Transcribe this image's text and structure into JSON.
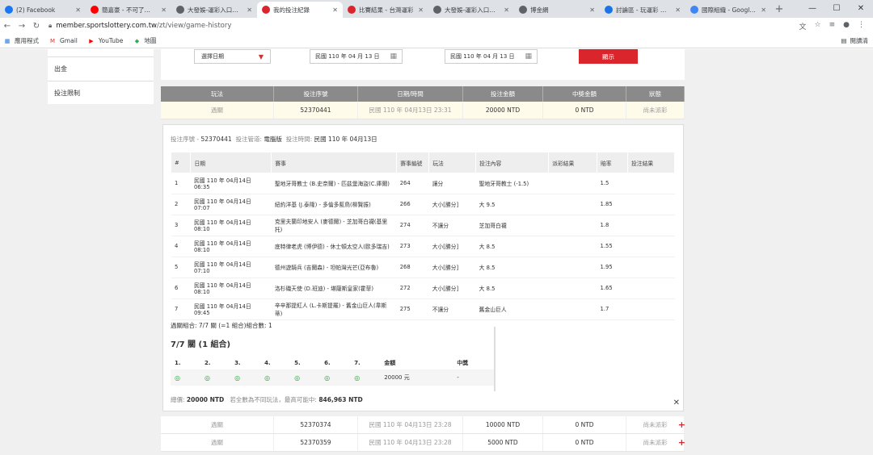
{
  "browser": {
    "tabs": [
      {
        "title": "(2) Facebook",
        "color": "#1877f2"
      },
      {
        "title": "簡嘉豪 - 不可了…",
        "color": "#ff0000"
      },
      {
        "title": "大發娛-運彩入口網 …",
        "color": "#5f6368"
      },
      {
        "title": "我的投注紀錄",
        "color": "#d9252b"
      },
      {
        "title": "比賽結果 - 台灣運彩",
        "color": "#d9252b"
      },
      {
        "title": "大發娛-運彩入口網 …",
        "color": "#5f6368"
      },
      {
        "title": "博金網",
        "color": "#5f6368"
      },
      {
        "title": "討論區 - 玩運彩 台灣 …",
        "color": "#1a73e8"
      },
      {
        "title": "國際組織 - Google 搜 …",
        "color": "#4285f4"
      }
    ],
    "url_host": "member.sportslottery.com.tw",
    "url_path": "/zt/view/game-history",
    "bookmarks": [
      "應用程式",
      "Gmail",
      "YouTube",
      "地圖"
    ],
    "reading_list": "閱讀清"
  },
  "sidebar": {
    "items": [
      "出金",
      "投注限制"
    ]
  },
  "filter": {
    "select_label": "選擇日期",
    "date_from": "民國 110 年 04 月 13 日",
    "date_to": "民國 110 年 04 月 13 日",
    "button": "顯示"
  },
  "history": {
    "headers": [
      "玩法",
      "投注序號",
      "日期/時間",
      "投注金額",
      "中獎金額",
      "狀態"
    ],
    "rows": [
      [
        "過關",
        "52370441",
        "民國 110 年 04月13日 23:31",
        "20000 NTD",
        "0 NTD",
        "尚未派彩"
      ],
      [
        "過關",
        "52370374",
        "民國 110 年 04月13日 23:28",
        "10000 NTD",
        "0 NTD",
        "尚未派彩"
      ],
      [
        "過關",
        "52370359",
        "民國 110 年 04月13日 23:28",
        "5000 NTD",
        "0 NTD",
        "尚未派彩"
      ]
    ]
  },
  "detail": {
    "serial_label": "投注序號",
    "serial": "52370441",
    "channel_label": "投注管道",
    "channel": "電腦版",
    "time_label": "投注時間",
    "time": "民國 110 年 04月13日",
    "headers": [
      "#",
      "日期",
      "賽事",
      "賽事編號",
      "玩法",
      "投注內容",
      "派彩結果",
      "賠率",
      "投注結果"
    ],
    "bets": [
      [
        "1",
        "民國 110 年 04月14日 06:35",
        "聖地牙哥教士 (B.史奈爾) - 匹茲堡海盜(C.庫爾)",
        "264",
        "讓分",
        "聖地牙哥教士 (-1.5)",
        "",
        "1.5",
        ""
      ],
      [
        "2",
        "民國 110 年 04月14日 07:07",
        "紐約洋基 (J.泰隆) - 多倫多藍鳥(柳賢振)",
        "266",
        "大小[勝分]",
        "大 9.5",
        "",
        "1.85",
        ""
      ],
      [
        "3",
        "民國 110 年 04月14日 08:10",
        "克里夫蘭印地安人 (麥德爾) - 芝加哥白襪(基里托)",
        "274",
        "不讓分",
        "芝加哥白襪",
        "",
        "1.8",
        ""
      ],
      [
        "4",
        "民國 110 年 04月14日 08:10",
        "底特律老虎 (博伊德) - 休士頓太空人(歐多瑞吉)",
        "273",
        "大小[勝分]",
        "大 8.5",
        "",
        "1.55",
        ""
      ],
      [
        "5",
        "民國 110 年 04月14日 07:10",
        "德州遊騎兵 (吉爾森) - 坦帕灣光芒(亞布魯)",
        "268",
        "大小[勝分]",
        "大 8.5",
        "",
        "1.95",
        ""
      ],
      [
        "6",
        "民國 110 年 04月14日 08:10",
        "洛杉磯天使 (D.班迪) - 堪薩斯皇家(霍菲)",
        "272",
        "大小[勝分]",
        "大 8.5",
        "",
        "1.65",
        ""
      ],
      [
        "7",
        "民國 110 年 04月14日 09:45",
        "辛辛那提紅人 (L.卡斯提羅) - 舊金山巨人(韋斯蒂)",
        "275",
        "不讓分",
        "舊金山巨人",
        "",
        "1.7",
        ""
      ]
    ],
    "combo_summary": "過關組合: 7/7 關 (=1 組合)組合數: 1",
    "combo_title": "7/7 關 (1 組合)",
    "combo_headers": [
      "1.",
      "2.",
      "3.",
      "4.",
      "5.",
      "6.",
      "7.",
      "金額",
      "中獎"
    ],
    "combo_amount": "20000 元",
    "combo_win": "-",
    "total_label": "總價:",
    "total": "20000 NTD",
    "max_label": "若全數為不同玩法，最高可能中:",
    "max": "846,963 NTD"
  }
}
